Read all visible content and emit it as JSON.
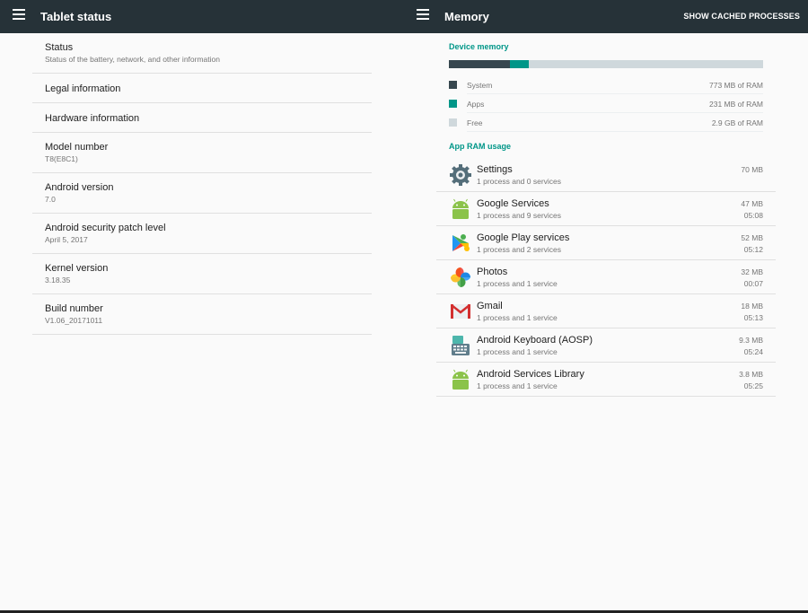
{
  "left_header": {
    "title": "Tablet status"
  },
  "right_header": {
    "title": "Memory",
    "action": "SHOW CACHED PROCESSES"
  },
  "status_items": [
    {
      "title": "Status",
      "subtitle": "Status of the battery, network, and other information"
    },
    {
      "title": "Legal information"
    },
    {
      "title": "Hardware information"
    },
    {
      "title": "Model number",
      "subtitle": "T8(E8C1)"
    },
    {
      "title": "Android version",
      "subtitle": "7.0"
    },
    {
      "title": "Android security patch level",
      "subtitle": "April 5, 2017"
    },
    {
      "title": "Kernel version",
      "subtitle": "3.18.35"
    },
    {
      "title": "Build number",
      "subtitle": "V1.06_20171011"
    }
  ],
  "device_memory": {
    "label": "Device memory",
    "bar_fractions": {
      "system": 0.195,
      "apps": 0.058
    },
    "colors": {
      "system": "#37474f",
      "apps": "#009688",
      "free": "#cfd8dc"
    },
    "legend": [
      {
        "name": "System",
        "value": "773 MB of RAM"
      },
      {
        "name": "Apps",
        "value": "231 MB of RAM"
      },
      {
        "name": "Free",
        "value": "2.9 GB of RAM"
      }
    ]
  },
  "app_ram": {
    "label": "App RAM usage",
    "apps": [
      {
        "name": "Settings",
        "detail": "1 process and 0 services",
        "size": "70 MB",
        "time": "",
        "icon": "settings-gear-icon"
      },
      {
        "name": "Google Services",
        "detail": "1 process and 9 services",
        "size": "47 MB",
        "time": "05:08",
        "icon": "android-robot-icon"
      },
      {
        "name": "Google Play services",
        "detail": "1 process and 2 services",
        "size": "52 MB",
        "time": "05:12",
        "icon": "puzzle-piece-icon"
      },
      {
        "name": "Photos",
        "detail": "1 process and 1 service",
        "size": "32 MB",
        "time": "00:07",
        "icon": "pinwheel-icon"
      },
      {
        "name": "Gmail",
        "detail": "1 process and 1 service",
        "size": "18 MB",
        "time": "05:13",
        "icon": "gmail-envelope-icon"
      },
      {
        "name": "Android Keyboard (AOSP)",
        "detail": "1 process and 1 service",
        "size": "9.3 MB",
        "time": "05:24",
        "icon": "keyboard-icon"
      },
      {
        "name": "Android Services Library",
        "detail": "1 process and 1 service",
        "size": "3.8 MB",
        "time": "05:25",
        "icon": "android-robot-icon"
      }
    ]
  }
}
